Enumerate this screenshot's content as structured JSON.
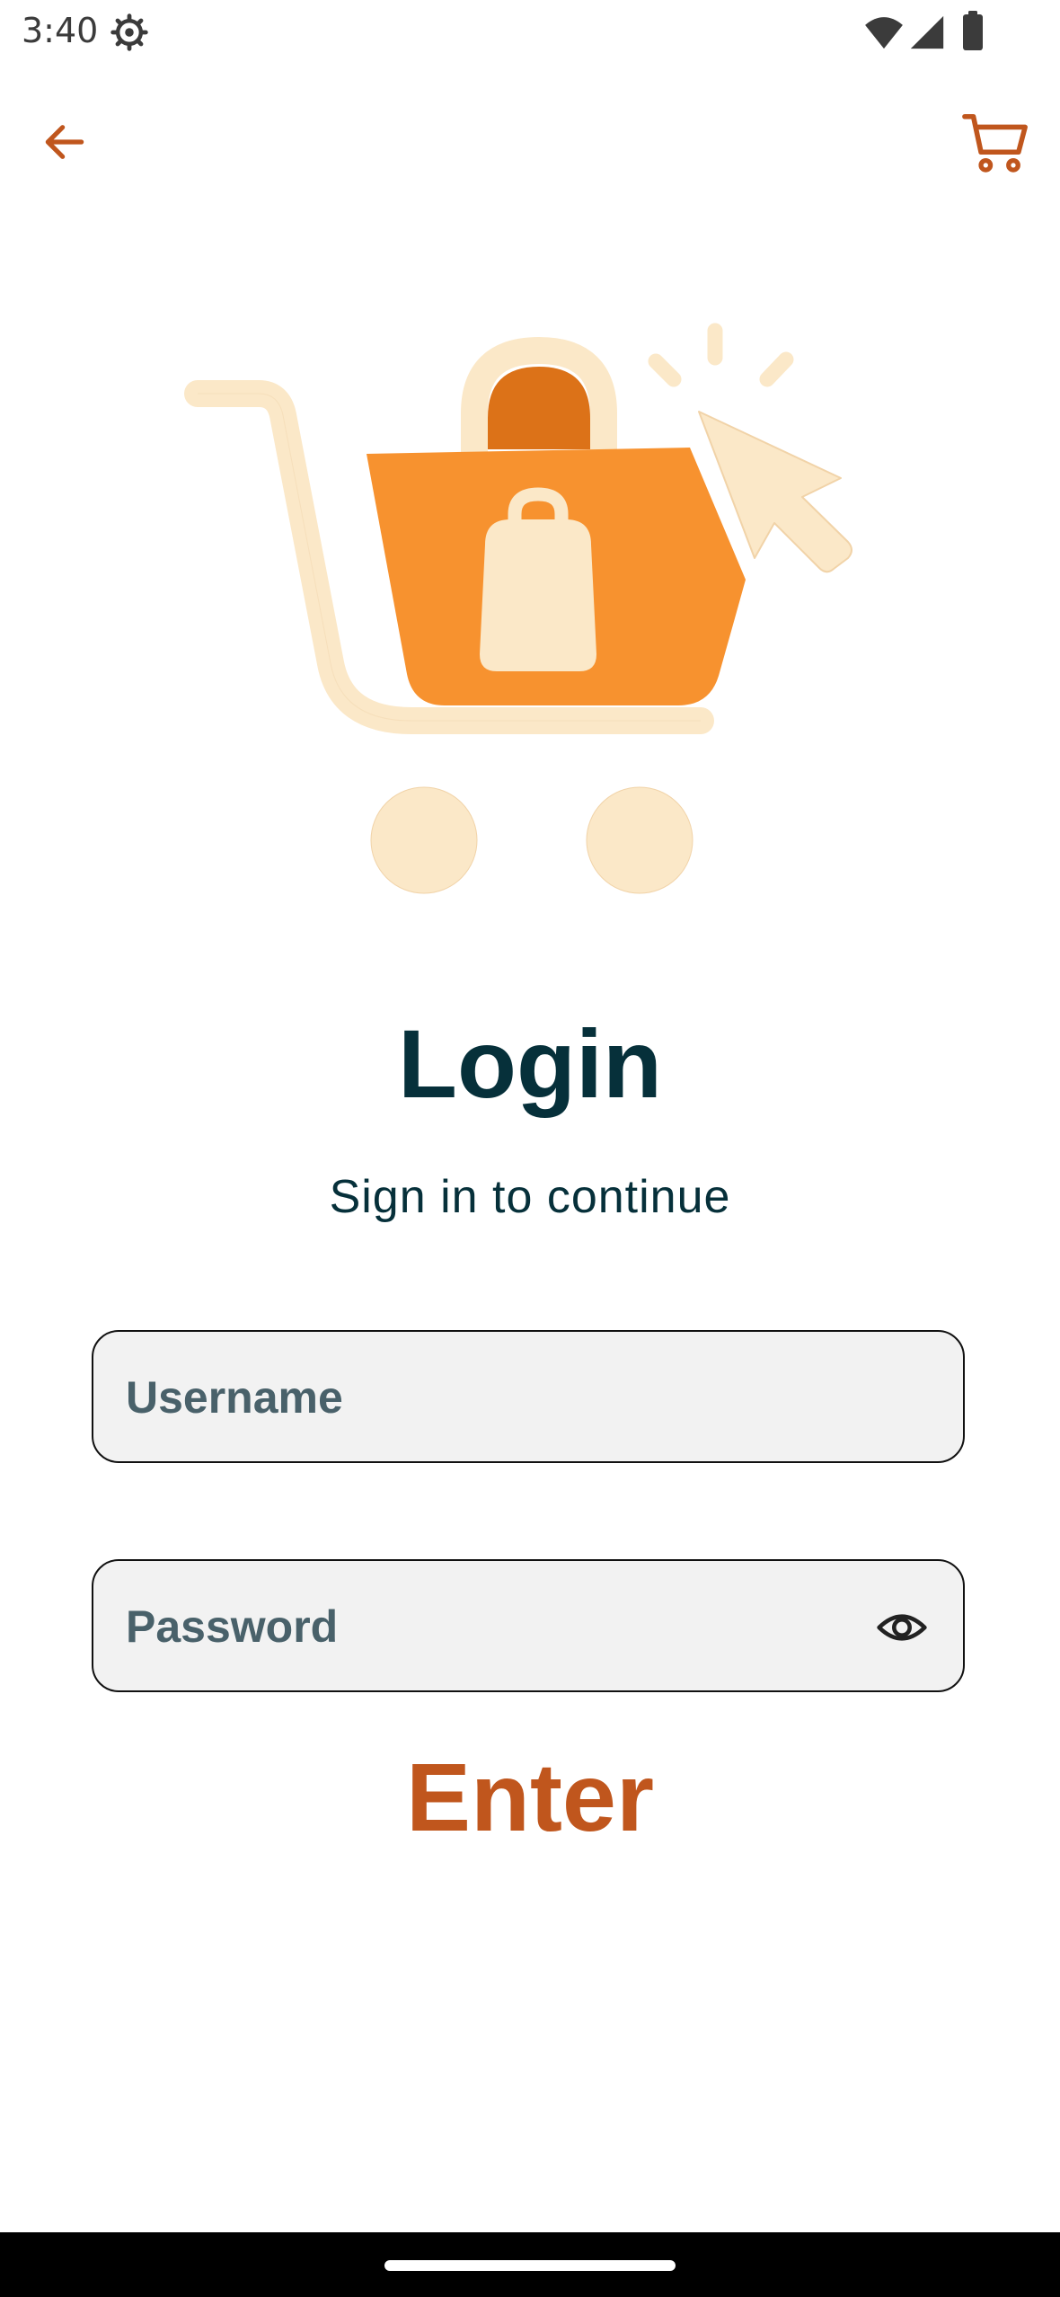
{
  "status_bar": {
    "time": "3:40",
    "icons": [
      "settings-gear-icon",
      "wifi-icon",
      "cellular-signal-icon",
      "battery-icon"
    ]
  },
  "app_bar": {
    "back_icon": "arrow-left-icon",
    "cart_icon": "shopping-cart-icon",
    "accent_color": "#c0561d"
  },
  "illustration": {
    "icon": "shopping-cart-with-bag-and-cursor-illustration",
    "colors": {
      "orange": "#f7922f",
      "dark_orange": "#dc7218",
      "cream": "#fbe8c8"
    }
  },
  "login": {
    "title": "Login",
    "subtitle": "Sign in to continue",
    "title_color": "#06303a"
  },
  "form": {
    "username": {
      "placeholder": "Username",
      "value": ""
    },
    "password": {
      "placeholder": "Password",
      "value": "",
      "toggle_icon": "eye-icon"
    },
    "submit_label": "Enter",
    "submit_color": "#c0561d"
  }
}
